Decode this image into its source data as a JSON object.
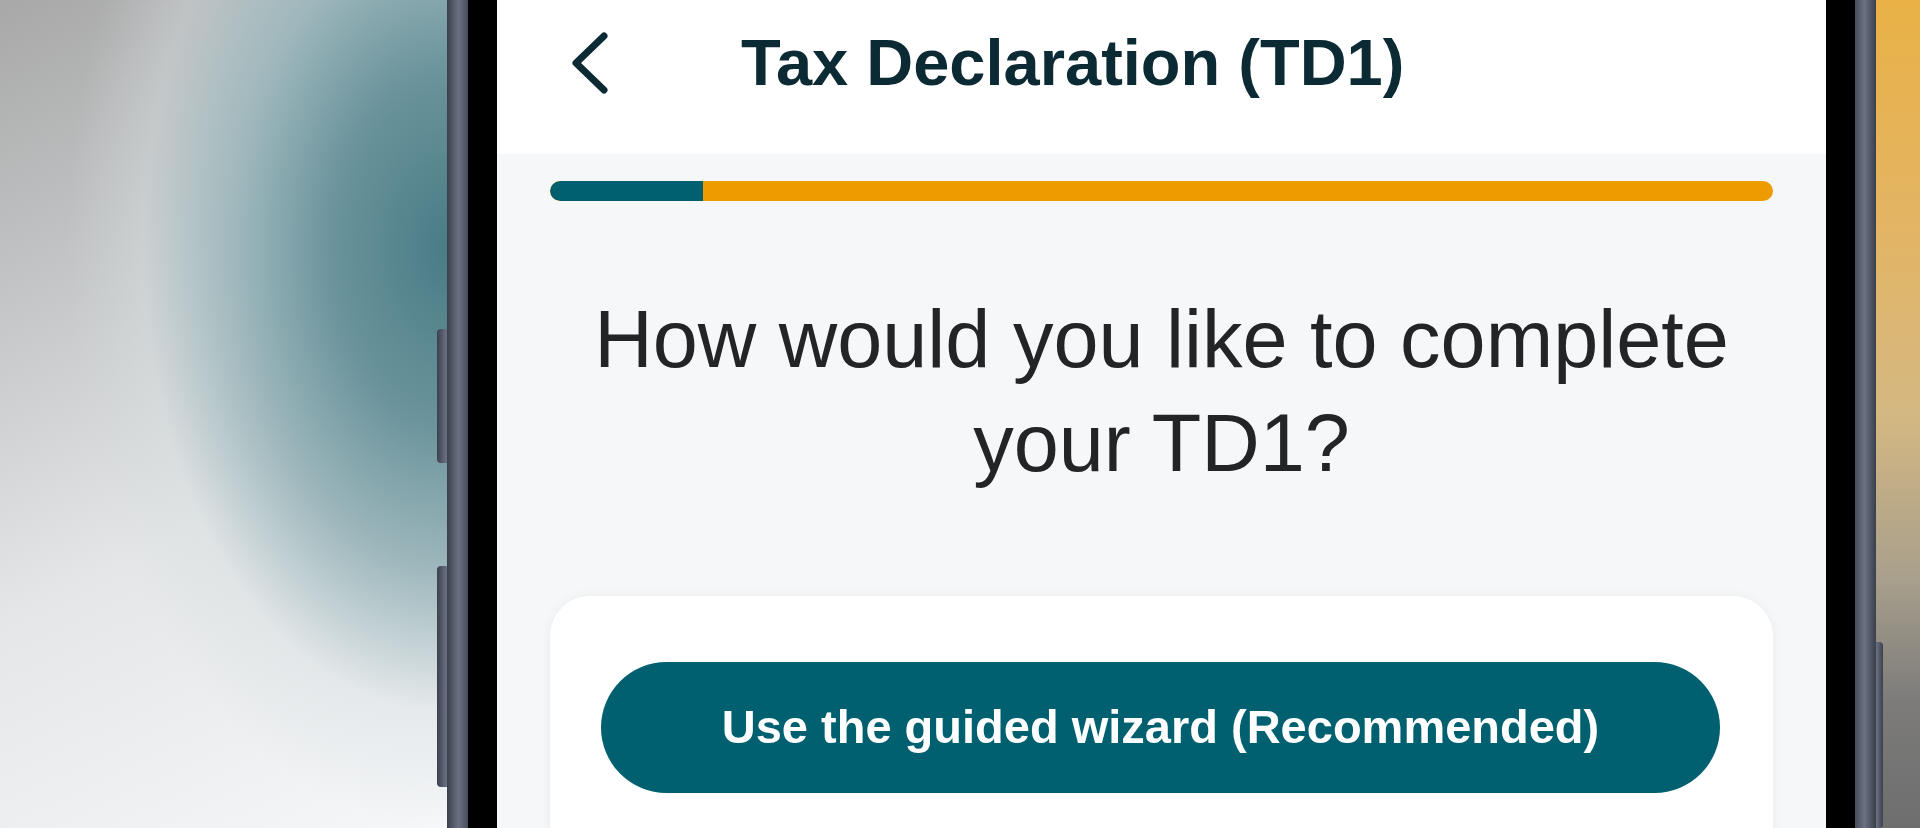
{
  "header": {
    "title": "Tax Declaration (TD1)"
  },
  "progress": {
    "level": 0.125
  },
  "question": "How would you like to complete your TD1?",
  "options": [
    {
      "label": "Use the guided wizard (Recommended)",
      "kind": "primary"
    }
  ]
}
